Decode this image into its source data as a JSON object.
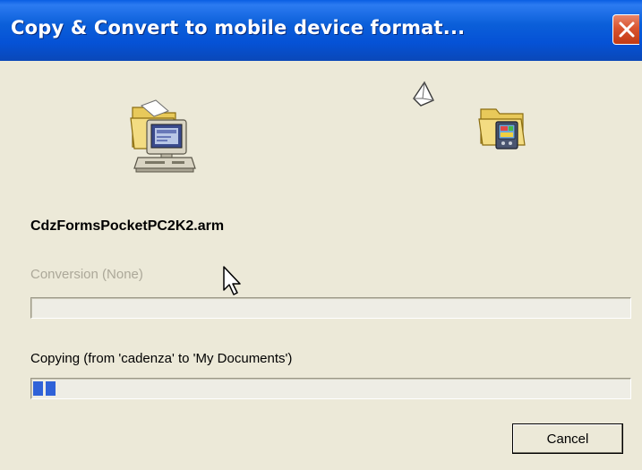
{
  "window": {
    "title": "Copy & Convert to mobile device format..."
  },
  "icons": {
    "source": "desktop-computer-folder-icon",
    "flying": "flying-paper-icon",
    "destination": "mobile-device-folder-icon"
  },
  "file": {
    "name": "CdzFormsPocketPC2K2.arm"
  },
  "conversion": {
    "label": "Conversion (None)",
    "progress": 0,
    "enabled": false
  },
  "copying": {
    "label": "Copying (from 'cadenza' to 'My Documents')",
    "progress_blocks": 2
  },
  "buttons": {
    "cancel": "Cancel"
  },
  "colors": {
    "titlebar": "#0552d6",
    "progress_fill": "#2f62d8",
    "disabled_text": "#aca899",
    "dialog_bg": "#ece9d8"
  }
}
